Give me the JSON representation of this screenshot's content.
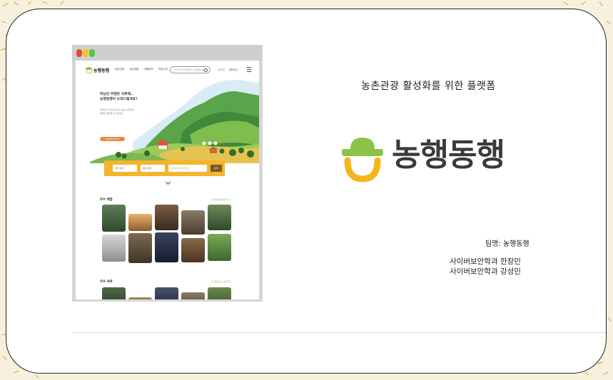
{
  "slide": {
    "subtitle": "농촌관광 활성화를 위한 플랫폼",
    "brand_name": "농행동행",
    "team_label": "팀명: 농행동행",
    "members": [
      "사이버보안학과 한창민",
      "사이버보안학과 강성민"
    ]
  },
  "mockup": {
    "logo_text": "농행동행",
    "nav": [
      "농촌관광",
      "농촌체험",
      "여행정보",
      "커뮤니티"
    ],
    "search_placeholder": "어디로 떠나볼까요? 검색해보세요",
    "util": [
      "로그인",
      "회원가입"
    ],
    "hero_title": "떠났던 여행은 지루해..\n농행동행이 도와드릴게요!",
    "hero_desc": "대한민국 곳곳에 숨겨진 농촌 여행지와\n특별한 체험을 만나보세요",
    "hero_button": "농촌여행 떠나기",
    "search_band": {
      "select1": "지역 선택",
      "select2": "체험 유형",
      "input": "검색어를 입력하세요",
      "button": "검색"
    },
    "sections": [
      {
        "title": "우수 체험",
        "more": "더 많은 체험 보러가기"
      },
      {
        "title": "우수 숙박",
        "more": "더 많은 숙소 보러가기"
      }
    ]
  },
  "colors": {
    "accent_green": "#8bc34a",
    "accent_yellow": "#f5b61a",
    "band_yellow": "#f3b52c",
    "hero_orange": "#f0863c",
    "brand_text": "#3a3a3a"
  }
}
